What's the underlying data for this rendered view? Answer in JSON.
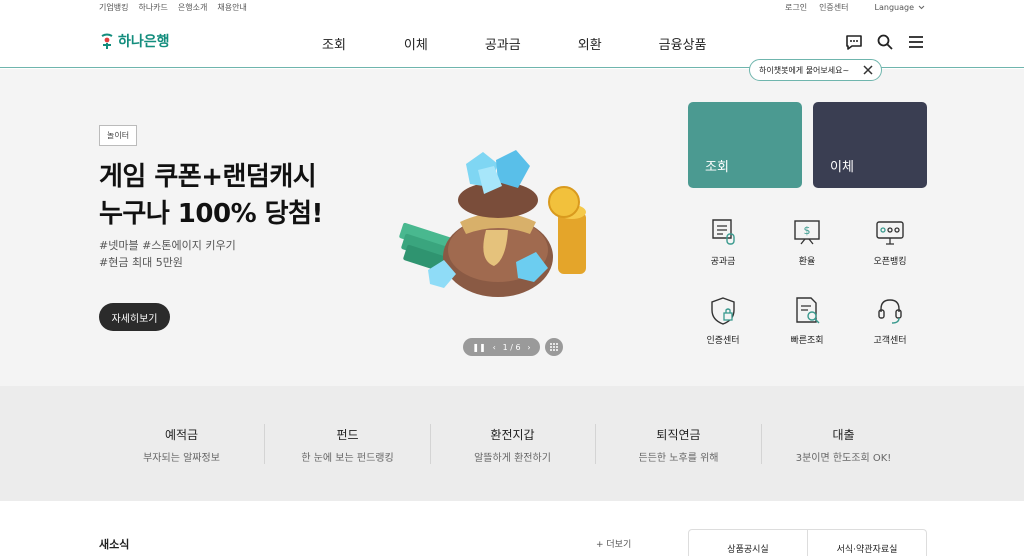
{
  "utility": {
    "left_links": [
      "기업뱅킹",
      "하나카드",
      "은행소개",
      "채용안내"
    ],
    "right_links": [
      "로그인",
      "인증센터"
    ],
    "language": "Language"
  },
  "header": {
    "logo_text": "하나은행",
    "nav": [
      "조회",
      "이체",
      "공과금",
      "외환",
      "금융상품"
    ],
    "icons": [
      "chatbot-icon",
      "search-icon",
      "menu-icon"
    ],
    "brand_color": "#138d7d"
  },
  "tooltip": {
    "text": "하이챗봇에게 물어보세요~"
  },
  "hero": {
    "badge": "놀이터",
    "headline_line1": "게임 쿠폰+랜덤캐시",
    "headline_line2": "누구나 100% 당첨!",
    "sub_line1": "#넷마블 #스톤에이지 키우기",
    "sub_line2": "#현금 최대 5만원",
    "button": "자세히보기",
    "pager": {
      "current": "1",
      "total": "6",
      "text": "1 / 6"
    }
  },
  "quick": {
    "cards": [
      {
        "label": "조회",
        "color": "#4b9a91"
      },
      {
        "label": "이체",
        "color": "#3a3e52"
      }
    ],
    "icons": [
      {
        "label": "공과금",
        "icon": "bill-icon"
      },
      {
        "label": "환율",
        "icon": "exchange-rate-icon"
      },
      {
        "label": "오픈뱅킹",
        "icon": "open-banking-icon"
      },
      {
        "label": "인증센터",
        "icon": "shield-lock-icon"
      },
      {
        "label": "빠른조회",
        "icon": "document-search-icon"
      },
      {
        "label": "고객센터",
        "icon": "headset-icon"
      }
    ]
  },
  "categories": [
    {
      "title": "예적금",
      "desc": "부자되는 알짜정보"
    },
    {
      "title": "펀드",
      "desc": "한 눈에 보는 펀드랭킹"
    },
    {
      "title": "환전지갑",
      "desc": "알뜰하게 환전하기"
    },
    {
      "title": "퇴직연금",
      "desc": "든든한 노후를 위해"
    },
    {
      "title": "대출",
      "desc": "3분이면 한도조회 OK!"
    }
  ],
  "news": {
    "title": "새소식",
    "more": "+ 더보기",
    "tabs": [
      "상품공시실",
      "서식·약관자료실"
    ]
  }
}
